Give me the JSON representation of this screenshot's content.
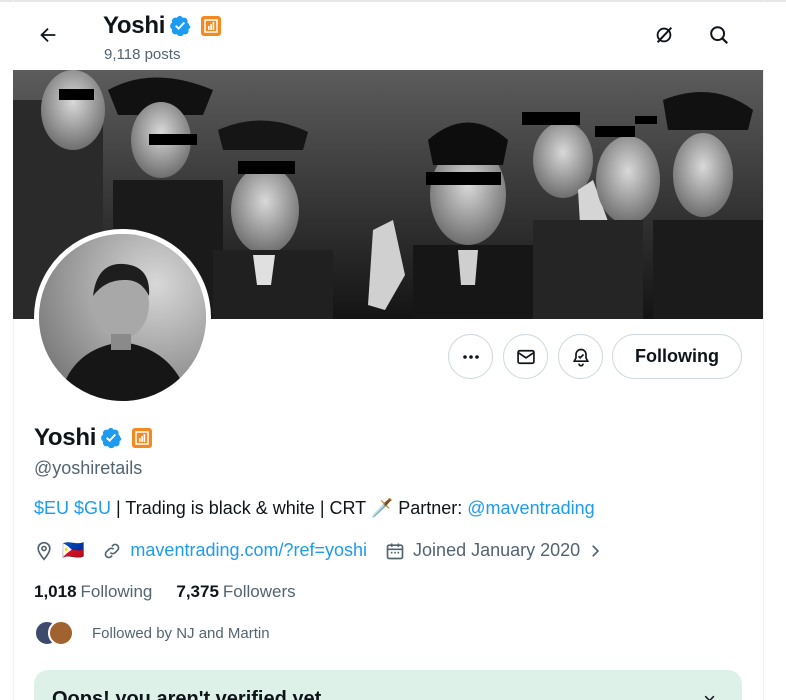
{
  "header": {
    "name": "Yoshi",
    "posts": "9,118 posts",
    "icons": [
      "back-arrow-icon",
      "grok-icon",
      "search-icon"
    ]
  },
  "profile": {
    "name": "Yoshi",
    "handle": "@yoshiretails",
    "bio": {
      "cashtag1": "$EU",
      "cashtag2": "$GU",
      "text": " | Trading is black & white | CRT 🗡️ Partner: ",
      "mention": "@maventrading"
    },
    "location_flag": "🇵🇭",
    "website": "maventrading.com/?ref=yoshi",
    "joined": "Joined January 2020",
    "following_count": "1,018",
    "following_label": "Following",
    "followers_count": "7,375",
    "followers_label": "Followers",
    "followed_by": "Followed by NJ and Martin"
  },
  "actions": {
    "following_button": "Following",
    "icons": [
      "more-icon",
      "message-icon",
      "notification-bell-icon"
    ]
  },
  "verify_banner": {
    "title": "Oops! you aren't verified yet",
    "close": "×"
  },
  "colors": {
    "accent": "#1d9bf0",
    "affiliate": "#f4891f",
    "secondary_text": "#536471",
    "verify_bg": "#def1e9"
  }
}
